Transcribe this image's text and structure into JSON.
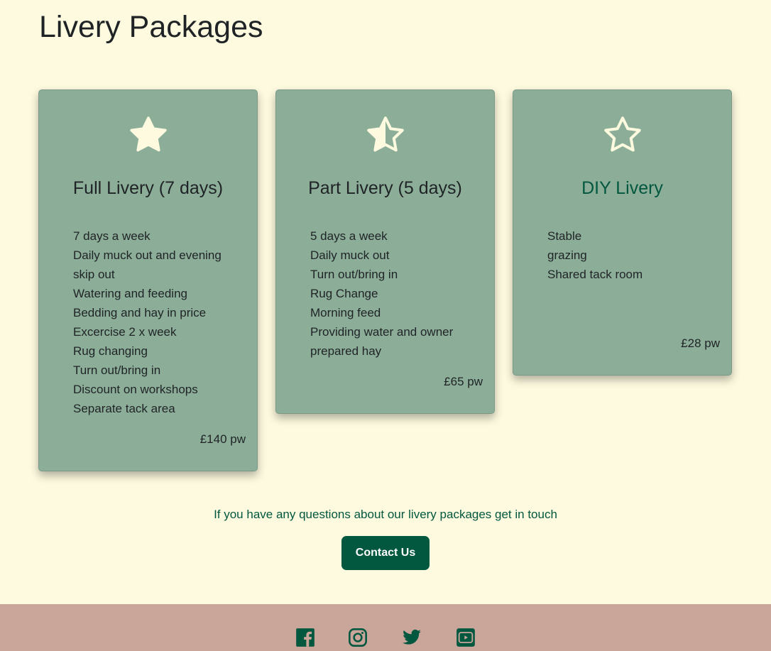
{
  "page_title": "Livery Packages",
  "packages": [
    {
      "icon": "star-full-icon",
      "title": "Full Livery (7 days)",
      "features": [
        "7 days a week",
        "Daily muck out and evening skip out",
        "Watering and feeding",
        "Bedding and hay in price",
        "Excercise 2 x week",
        "Rug changing",
        "Turn out/bring in",
        "Discount on workshops",
        "Separate tack area"
      ],
      "price": "£140 pw"
    },
    {
      "icon": "star-half-icon",
      "title": "Part Livery (5 days)",
      "features": [
        "5 days a week",
        "Daily muck out",
        "Turn out/bring in",
        "Rug Change",
        "Morning feed",
        "Providing water and owner prepared hay"
      ],
      "price": "£65 pw"
    },
    {
      "icon": "star-outline-icon",
      "title": "DIY Livery",
      "features": [
        "Stable",
        "grazing",
        "Shared tack room"
      ],
      "price": "£28 pw"
    }
  ],
  "contact": {
    "note": "If you have any questions about our livery packages get in touch",
    "button": "Contact Us"
  },
  "footer": {
    "social": [
      "facebook-icon",
      "instagram-icon",
      "twitter-icon",
      "youtube-icon"
    ]
  },
  "colors": {
    "background": "#fdfadf",
    "card": "#8cae99",
    "accent": "#02573f",
    "footer": "#c9a59a",
    "star": "#fdfadf"
  }
}
